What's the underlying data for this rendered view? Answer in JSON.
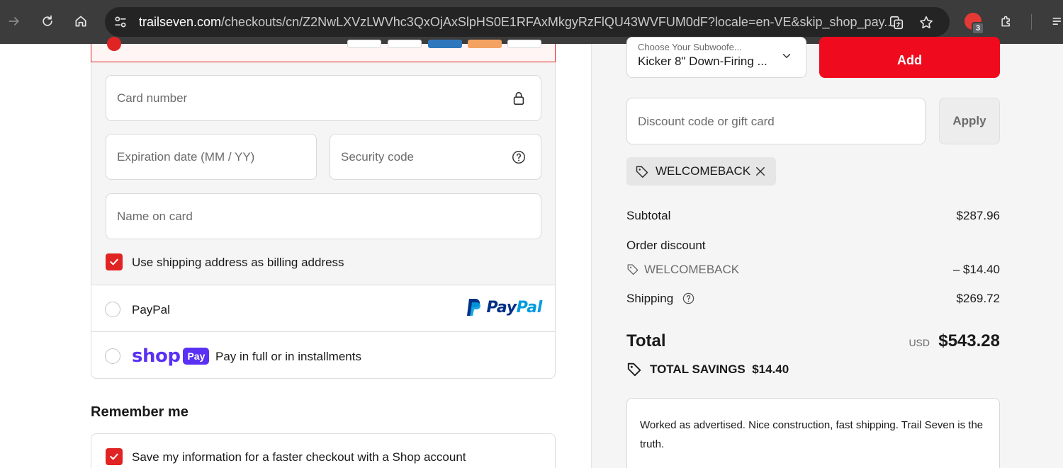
{
  "browser": {
    "url_host": "trailseven.com",
    "url_path": "/checkouts/cn/Z2NwLXVzLWVhc3QxOjAxSlpHS0E1RFAxMkgyRzFlQU43WVFUM0dF?locale=en-VE&skip_shop_pay...",
    "extension_badge_count": "3"
  },
  "payment": {
    "card_number_placeholder": "Card number",
    "expiration_placeholder": "Expiration date (MM / YY)",
    "security_code_placeholder": "Security code",
    "name_placeholder": "Name on card",
    "billing_checkbox_label": "Use shipping address as billing address",
    "paypal_label": "PayPal",
    "paypal_logo_pay": "Pay",
    "paypal_logo_pal": "Pal",
    "shoppay_logo_word": "shop",
    "shoppay_logo_pill": "Pay",
    "shoppay_label": "Pay in full or in installments"
  },
  "remember": {
    "heading": "Remember me",
    "save_label": "Save my information for a faster checkout with a Shop account"
  },
  "upsell": {
    "select_label": "Choose Your Subwoofe...",
    "select_value": "Kicker 8\" Down-Firing ...",
    "add_label": "Add"
  },
  "discount": {
    "placeholder": "Discount code or gift card",
    "apply_label": "Apply",
    "applied_code": "WELCOMEBACK"
  },
  "summary": {
    "subtotal_label": "Subtotal",
    "subtotal_value": "$287.96",
    "order_discount_label": "Order discount",
    "discount_code": "WELCOMEBACK",
    "discount_value": "– $14.40",
    "shipping_label": "Shipping",
    "shipping_value": "$269.72",
    "total_label": "Total",
    "total_currency": "USD",
    "total_value": "$543.28",
    "savings_label": "TOTAL SAVINGS",
    "savings_value": "$14.40"
  },
  "review": {
    "text": "Worked as advertised. Nice construction, fast shipping. Trail Seven is the truth."
  },
  "colors": {
    "brand_red": "#ef0a1e",
    "selected_red": "#e02424",
    "shop_purple": "#5a31f4",
    "paypal_dark": "#003087",
    "paypal_light": "#009cde"
  },
  "icons": [
    "forward-icon",
    "reload-icon",
    "home-icon",
    "site-info-icon",
    "translate-icon",
    "star-icon",
    "extension-icon",
    "puzzle-icon",
    "lock-icon",
    "help-icon",
    "chevron-down-icon",
    "tag-icon",
    "close-icon",
    "savings-tag-icon"
  ]
}
